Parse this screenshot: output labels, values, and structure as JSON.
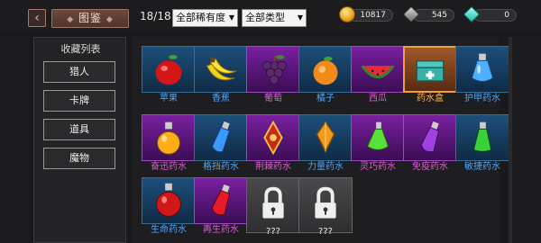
{
  "header": {
    "back_icon": "chevron-left-icon",
    "title": "图鉴",
    "count": "18/18",
    "rarity_filter": "全部稀有度",
    "type_filter": "全部类型"
  },
  "currencies": [
    {
      "icon": "gold-coin-icon",
      "value": "10817"
    },
    {
      "icon": "gray-gem-icon",
      "value": "545"
    },
    {
      "icon": "teal-gem-icon",
      "value": "0"
    }
  ],
  "sidebar": {
    "title": "收藏列表",
    "items": [
      {
        "label": "猎人"
      },
      {
        "label": "卡牌"
      },
      {
        "label": "道具"
      },
      {
        "label": "魔物"
      }
    ]
  },
  "items": [
    {
      "name": "苹果",
      "rarity": "blue",
      "icon": "apple-icon"
    },
    {
      "name": "香蕉",
      "rarity": "blue",
      "icon": "banana-icon"
    },
    {
      "name": "葡萄",
      "rarity": "purple",
      "icon": "grapes-icon"
    },
    {
      "name": "橘子",
      "rarity": "blue",
      "icon": "orange-icon"
    },
    {
      "name": "西瓜",
      "rarity": "purple",
      "icon": "watermelon-icon"
    },
    {
      "name": "药水盒",
      "rarity": "orange",
      "icon": "potion-chest-icon"
    },
    {
      "name": "护甲药水",
      "rarity": "blue",
      "icon": "armor-potion-icon"
    },
    {
      "name": "奋迅药水",
      "rarity": "purple",
      "icon": "haste-potion-icon"
    },
    {
      "name": "格挡药水",
      "rarity": "blue",
      "icon": "block-potion-icon"
    },
    {
      "name": "荆棘药水",
      "rarity": "purple",
      "icon": "thorns-potion-icon"
    },
    {
      "name": "力量药水",
      "rarity": "blue",
      "icon": "strength-potion-icon"
    },
    {
      "name": "灵巧药水",
      "rarity": "purple",
      "icon": "dexterity-potion-icon"
    },
    {
      "name": "免疫药水",
      "rarity": "purple",
      "icon": "immunity-potion-icon"
    },
    {
      "name": "敏捷药水",
      "rarity": "blue",
      "icon": "agility-potion-icon"
    },
    {
      "name": "生命药水",
      "rarity": "blue",
      "icon": "health-potion-icon"
    },
    {
      "name": "再生药水",
      "rarity": "purple",
      "icon": "regen-potion-icon"
    },
    {
      "name": "???",
      "rarity": "gray",
      "icon": "lock-icon"
    },
    {
      "name": "???",
      "rarity": "gray",
      "icon": "lock-icon"
    }
  ],
  "colors": {
    "blue_rarity": "#49a6ff",
    "purple_rarity": "#e05ad8",
    "orange_rarity": "#ffb340"
  }
}
